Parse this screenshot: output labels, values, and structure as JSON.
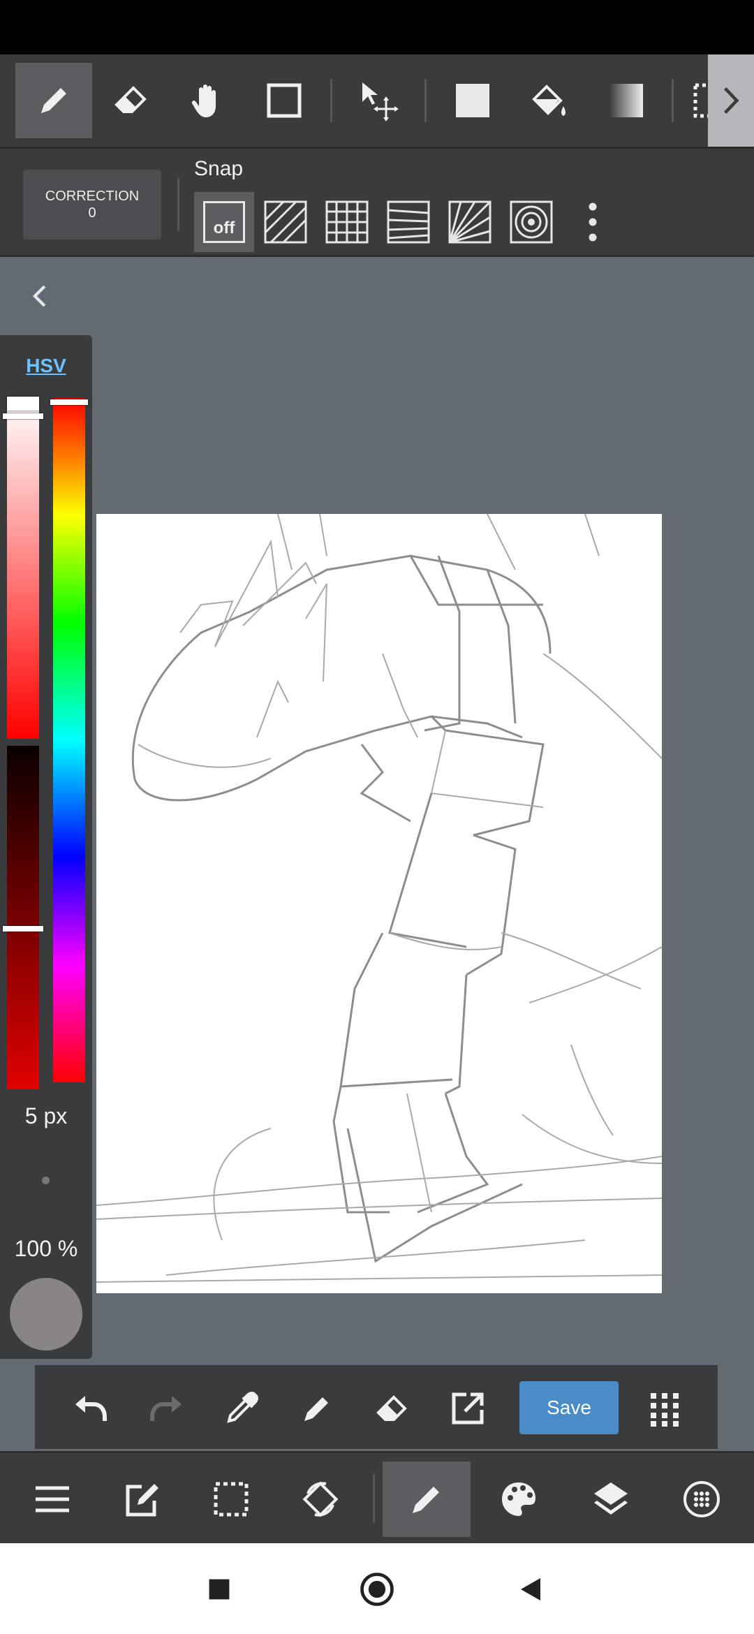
{
  "toolbar": {
    "tools": [
      {
        "name": "pen-tool",
        "icon": "pen-icon",
        "active": true
      },
      {
        "name": "eraser-tool",
        "icon": "eraser-icon"
      },
      {
        "name": "hand-tool",
        "icon": "hand-icon"
      },
      {
        "name": "shape-tool",
        "icon": "square-outline-icon"
      },
      {
        "name": "move-tool",
        "icon": "move-arrow-icon"
      },
      {
        "name": "fill-rect-tool",
        "icon": "filled-square-icon"
      },
      {
        "name": "bucket-tool",
        "icon": "paint-bucket-icon"
      },
      {
        "name": "gradient-tool",
        "icon": "gradient-icon"
      },
      {
        "name": "select-tool",
        "icon": "dotted-selection-icon"
      }
    ]
  },
  "snapbar": {
    "correction_label": "CORRECTION",
    "correction_value": "0",
    "snap_label": "Snap",
    "snap_off_label": "off",
    "snap_modes": [
      "off",
      "parallel",
      "grid",
      "perspective-parallel",
      "radial",
      "concentric"
    ]
  },
  "color_panel": {
    "mode_label": "HSV",
    "brush_size": "5 px",
    "opacity": "100 %",
    "current_color": "#888584"
  },
  "actions": {
    "save_label": "Save",
    "items": [
      "undo-icon",
      "redo-icon",
      "eyedropper-icon",
      "pen-icon",
      "eraser-icon",
      "export-icon",
      "save",
      "grid-dots-icon"
    ]
  },
  "bottom_nav": {
    "items": [
      "menu-icon",
      "edit-icon",
      "selection-icon",
      "rotate-icon",
      "brush-icon",
      "palette-icon",
      "layers-icon",
      "material-icon"
    ],
    "active": "brush-icon"
  },
  "system_nav": [
    "recents-icon",
    "home-icon",
    "back-icon"
  ],
  "colors": {
    "accent": "#4a8cc8",
    "panel": "#3a3b3d",
    "background": "#646a72",
    "hsv_link": "#6fc2ff"
  }
}
